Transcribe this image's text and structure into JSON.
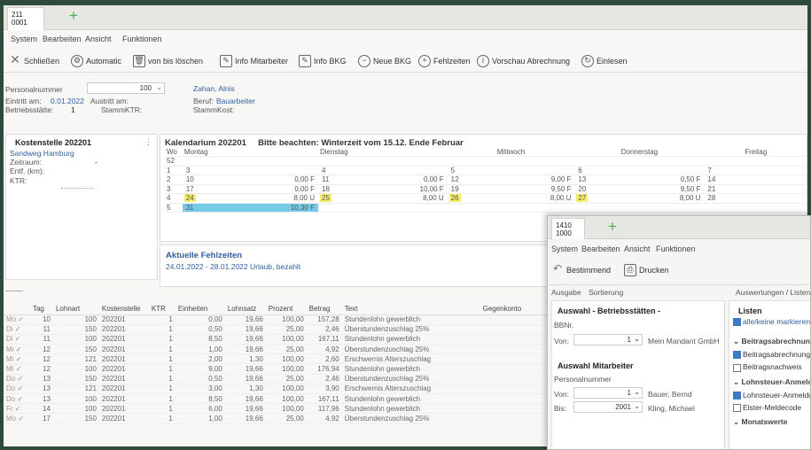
{
  "main_window": {
    "tab_label": "211\n0001",
    "menu": [
      "System",
      "Bearbeiten",
      "Ansicht",
      "Funktionen"
    ],
    "toolbar": [
      {
        "icon": "close-icon",
        "label": "Schließen"
      },
      {
        "icon": "gear-icon",
        "label": "Automatic"
      },
      {
        "icon": "trash-icon",
        "label": "von bis löschen"
      },
      {
        "icon": "edit-icon",
        "label": "Info Mitarbeiter"
      },
      {
        "icon": "edit-icon",
        "label": "Info BKG"
      },
      {
        "icon": "minus-circle-icon",
        "label": "Neue BKG"
      },
      {
        "icon": "plus-circle-icon",
        "label": "Fehlzeiten"
      },
      {
        "icon": "info-icon",
        "label": "Vorschau Abrechnung"
      },
      {
        "icon": "refresh-icon",
        "label": "Einlesen"
      }
    ],
    "header": {
      "personalnummer_label": "Personalnummer",
      "personalnummer_value": "100",
      "name": "Zahan, Alnis",
      "eintritt_label": "Eintritt am:",
      "eintritt_value": "0.01.2022",
      "austritt_label": "Austritt am:",
      "beruf_label": "Beruf:",
      "beruf_value": "Bauarbeiter",
      "betriebsstaette_label": "Betriebsstätte:",
      "betriebsstaette_value": "1",
      "stammktr_label": "StammKTR:",
      "stammkost_label": "StammKost:"
    },
    "kostenstelle": {
      "title": "Kostenstelle 202201",
      "address": "Sandweg Hamburg",
      "zeitraum_label": "Zeitraum:",
      "zeitraum_value": "-",
      "entf_label": "Entf. (km):",
      "ktr_label": "KTR:"
    },
    "kalendarium": {
      "title": "Kalendarium 202201",
      "notice": "Bitte beachten: Winterzeit vom 15.12. Ende Februar",
      "wo_label": "Wo",
      "columns": [
        "Montag",
        "Dienstag",
        "Mittwoch",
        "Donnerstag",
        "Freitag"
      ],
      "week_numbers": [
        "52",
        "1",
        "2",
        "3",
        "4",
        "5"
      ],
      "rows": [
        [
          {
            "d": "",
            "h": ""
          },
          {
            "d": "",
            "h": ""
          },
          {
            "d": "",
            "h": ""
          },
          {
            "d": "",
            "h": ""
          },
          {
            "d": "",
            "h": ""
          }
        ],
        [
          {
            "d": "3",
            "h": ""
          },
          {
            "d": "4",
            "h": ""
          },
          {
            "d": "5",
            "h": ""
          },
          {
            "d": "6",
            "h": ""
          },
          {
            "d": "7",
            "h": ""
          }
        ],
        [
          {
            "d": "10",
            "h": "0,00 F"
          },
          {
            "d": "11",
            "h": "0,00 F"
          },
          {
            "d": "12",
            "h": "9,00 F"
          },
          {
            "d": "13",
            "h": "0,50 F"
          },
          {
            "d": "14",
            "h": ""
          }
        ],
        [
          {
            "d": "17",
            "h": "0,00 F"
          },
          {
            "d": "18",
            "h": "10,00 F"
          },
          {
            "d": "19",
            "h": "9,50 F"
          },
          {
            "d": "20",
            "h": "9,50 F"
          },
          {
            "d": "21",
            "h": ""
          }
        ],
        [
          {
            "d": "24",
            "h": "8,00 U"
          },
          {
            "d": "25",
            "h": "8,00 U"
          },
          {
            "d": "26",
            "h": "8,00 U"
          },
          {
            "d": "27",
            "h": "8,00 U"
          },
          {
            "d": "28",
            "h": ""
          }
        ],
        [
          {
            "d": "31",
            "h": "10,30 F"
          },
          {
            "d": "",
            "h": ""
          },
          {
            "d": "",
            "h": ""
          },
          {
            "d": "",
            "h": ""
          },
          {
            "d": "",
            "h": ""
          }
        ]
      ]
    },
    "fehlzeiten": {
      "title": "Aktuelle Fehlzeiten",
      "entry": "24.01.2022 - 28.01.2022 Urlaub, bezahlt"
    },
    "grid": {
      "headers": [
        "",
        "Tag",
        "Lohnart",
        "Kostenstelle",
        "KTR",
        "Einheiten",
        "Lohnsatz",
        "Prozent",
        "Betrag",
        "Text",
        "Gegenkonto"
      ],
      "rows": [
        [
          "Mo",
          "10",
          "100",
          "202201",
          "1",
          "0,00",
          "19,66",
          "100,00",
          "157,28",
          "Stundenlohn gewerblich",
          ""
        ],
        [
          "Di",
          "11",
          "150",
          "202201",
          "1",
          "0,50",
          "19,66",
          "25,00",
          "2,46",
          "Überstundenzuschlag 25%",
          ""
        ],
        [
          "Di",
          "11",
          "100",
          "202201",
          "1",
          "8,50",
          "19,66",
          "100,00",
          "167,11",
          "Stundenlohn gewerblich",
          ""
        ],
        [
          "Mi",
          "12",
          "150",
          "202201",
          "1",
          "1,00",
          "19,66",
          "25,00",
          "4,92",
          "Überstundenzuschlag 25%",
          ""
        ],
        [
          "Mi",
          "12",
          "121",
          "202201",
          "1",
          "2,00",
          "1,30",
          "100,00",
          "2,60",
          "Erschwernis Alterszuschlag",
          ""
        ],
        [
          "Mi",
          "12",
          "100",
          "202201",
          "1",
          "9,00",
          "19,66",
          "100,00",
          "176,94",
          "Stundenlohn gewerblich",
          ""
        ],
        [
          "Do",
          "13",
          "150",
          "202201",
          "1",
          "0,50",
          "19,66",
          "25,00",
          "2,46",
          "Überstundenzuschlag 25%",
          ""
        ],
        [
          "Do",
          "13",
          "121",
          "202201",
          "1",
          "3,00",
          "1,30",
          "100,00",
          "3,90",
          "Erschwernis Alterszuschlag",
          ""
        ],
        [
          "Do",
          "13",
          "100",
          "202201",
          "1",
          "8,50",
          "19,66",
          "100,00",
          "167,11",
          "Stundenlohn gewerblich",
          ""
        ],
        [
          "Fr",
          "14",
          "100",
          "202201",
          "1",
          "6,00",
          "19,66",
          "100,00",
          "117,96",
          "Stundenlohn gewerblich",
          ""
        ],
        [
          "Mo",
          "17",
          "150",
          "202201",
          "1",
          "1,00",
          "19,66",
          "25,00",
          "4,92",
          "Überstundenzuschlag 25%",
          ""
        ]
      ]
    }
  },
  "second_window": {
    "tab_label": "1410\n1000",
    "menu": [
      "System",
      "Bearbeiten",
      "Ansicht",
      "Funktionen"
    ],
    "toolbar": [
      {
        "icon": "undo-icon",
        "label": "Bestimmend"
      },
      {
        "icon": "printer-icon",
        "label": "Drucken"
      }
    ],
    "subtabs": [
      "Ausgabe",
      "Sortierung"
    ],
    "right_tab": "Auswertungen / Listen",
    "betriebsstaetten": {
      "title": "Auswahl - Betriebsstätten -",
      "sub_label": "BBNr.",
      "von_label": "Von:",
      "von_value": "1",
      "von_name": "Mein Mandant GmbH"
    },
    "mitarbeiter": {
      "title": "Auswahl Mitarbeiter",
      "sub_label": "Personalnummer",
      "von_label": "Von:",
      "von_value": "1",
      "von_name": "Bauer, Bernd",
      "bis_label": "Bis:",
      "bis_value": "2001",
      "bis_name": "Kling, Michael"
    },
    "listen": {
      "title": "Listen",
      "all_label": "alle/keine markieren",
      "groups": [
        {
          "title": "Beitragsabrechnung",
          "items": [
            {
              "label": "Beitragsabrechnung",
              "checked": true
            },
            {
              "label": "Beitragsnachweis",
              "checked": false
            }
          ]
        },
        {
          "title": "Lohnsteuer-Anmeldung",
          "items": [
            {
              "label": "Lohnsteuer-Anmeldung",
              "checked": true
            },
            {
              "label": "Elster-Meldecode",
              "checked": false
            }
          ]
        },
        {
          "title": "Monatswerte",
          "items": []
        }
      ]
    }
  }
}
